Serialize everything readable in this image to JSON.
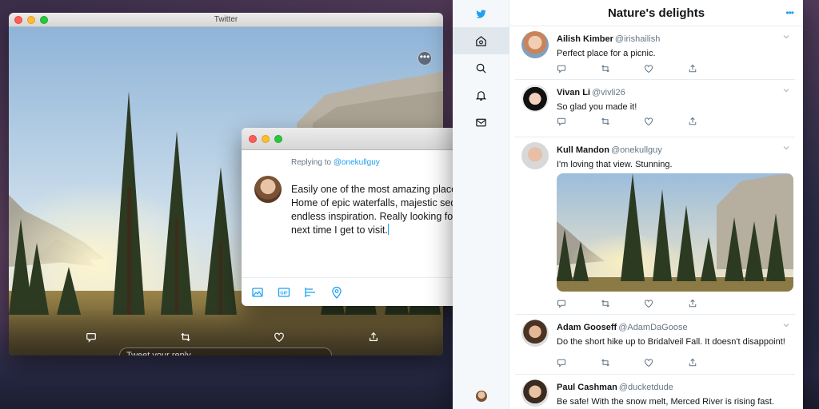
{
  "photo_window": {
    "title": "Twitter",
    "reply_placeholder": "Tweet your reply",
    "more_label": "•••"
  },
  "compose": {
    "replying_prefix": "Replying to",
    "replying_handle": "@onekullguy",
    "text": "Easily one of the most amazing places on earth. Home of epic waterfalls, majestic sequoias, and endless inspiration. Really looking forward to the next time I get to visit."
  },
  "timeline": {
    "title": "Nature's delights",
    "more_label": "•••",
    "tweets": [
      {
        "name": "Ailish Kimber",
        "handle": "@irishailish",
        "text": "Perfect place for a picnic."
      },
      {
        "name": "Vivan Li",
        "handle": "@vivli26",
        "text": "So glad you made it!"
      },
      {
        "name": "Kull Mandon",
        "handle": "@onekullguy",
        "text": "I'm loving that view. Stunning."
      },
      {
        "name": "Adam Gooseff",
        "handle": "@AdamDaGoose",
        "text": "Do the short hike up to Bridalveil Fall. It doesn't disappoint!"
      },
      {
        "name": "Paul Cashman",
        "handle": "@ducketdude",
        "text": "Be safe! With the snow melt, Merced River is rising fast."
      }
    ]
  },
  "colors": {
    "accent": "#1da1f2",
    "text": "#14171a",
    "muted": "#657786"
  }
}
